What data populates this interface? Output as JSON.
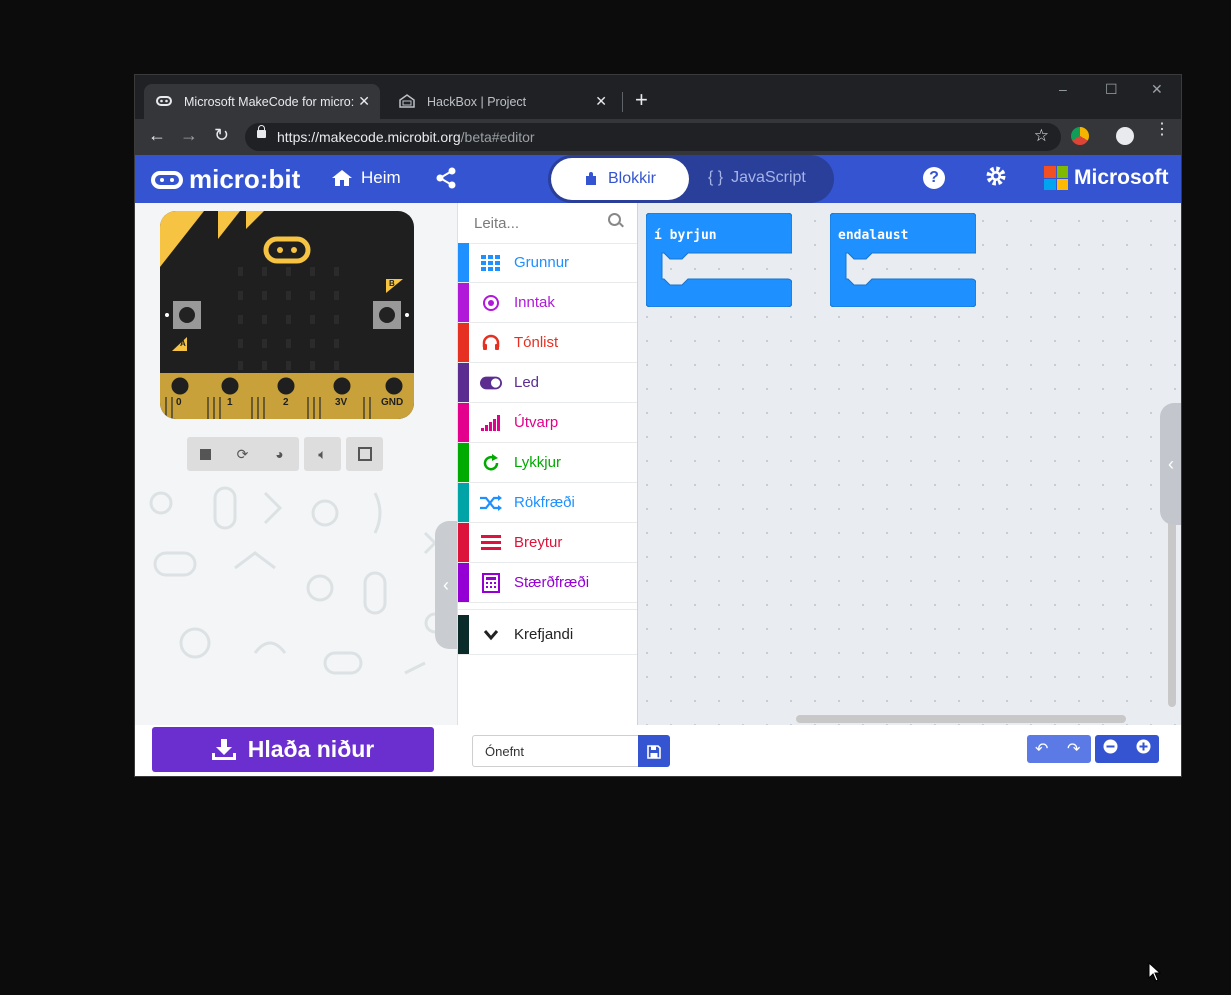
{
  "browser": {
    "tabs": [
      {
        "title": "Microsoft MakeCode for micro:bit",
        "close": "✕"
      },
      {
        "title": "HackBox | Project",
        "close": "✕"
      }
    ],
    "new_tab": "+",
    "window_controls": {
      "minimize": "–",
      "maximize": "☐",
      "close": "✕"
    },
    "nav": {
      "back": "←",
      "forward": "→",
      "reload": "↻"
    },
    "url_host": "https://makecode.microbit.org",
    "url_path": "/beta#editor",
    "star": "☆",
    "menu": "⋮"
  },
  "header": {
    "logo_text": "micro:bit",
    "home_label": "Heim",
    "blocks_label": "Blokkir",
    "javascript_label": "JavaScript",
    "javascript_icon": "{ }",
    "help": "?",
    "brand": "Microsoft",
    "brand_colors": [
      "#f25022",
      "#7fba00",
      "#00a4ef",
      "#ffb900"
    ]
  },
  "simulator": {
    "pin_labels": [
      "0",
      "1",
      "2",
      "3V",
      "GND"
    ],
    "button_a": "A",
    "button_b": "B",
    "controls": [
      "stop-icon",
      "restart-icon",
      "slow-mo-icon",
      "mute-icon",
      "fullscreen-icon"
    ]
  },
  "toolbox": {
    "search_placeholder": "Leita...",
    "categories": [
      {
        "label": "Grunnur",
        "color": "#1e90ff",
        "icon": "grid-icon"
      },
      {
        "label": "Inntak",
        "color": "#b019d8",
        "icon": "target-icon"
      },
      {
        "label": "Tónlist",
        "color": "#e63022",
        "icon": "headphones-icon"
      },
      {
        "label": "Led",
        "color": "#5c2d91",
        "icon": "toggle-icon"
      },
      {
        "label": "Útvarp",
        "color": "#e3008c",
        "icon": "signal-bars-icon"
      },
      {
        "label": "Lykkjur",
        "color": "#00aa00",
        "icon": "loop-icon"
      },
      {
        "label": "Rökfræði",
        "color": "#00a4a6",
        "icon": "shuffle-icon"
      },
      {
        "label": "Breytur",
        "color": "#dc143c",
        "icon": "lines-icon"
      },
      {
        "label": "Stærðfræði",
        "color": "#9400d3",
        "icon": "calculator-icon"
      }
    ],
    "advanced": {
      "label": "Krefjandi",
      "color": "#0b2a2a",
      "icon": "chevron-down-icon"
    }
  },
  "workspace": {
    "blocks": [
      {
        "label": "í byrjun",
        "color": "#1e90ff"
      },
      {
        "label": "endalaust",
        "color": "#1e90ff"
      }
    ]
  },
  "footer": {
    "download_label": "Hlaða niður",
    "project_name": "Ónefnt"
  },
  "accent": "#3454d1",
  "download_color": "#6b2fd0"
}
